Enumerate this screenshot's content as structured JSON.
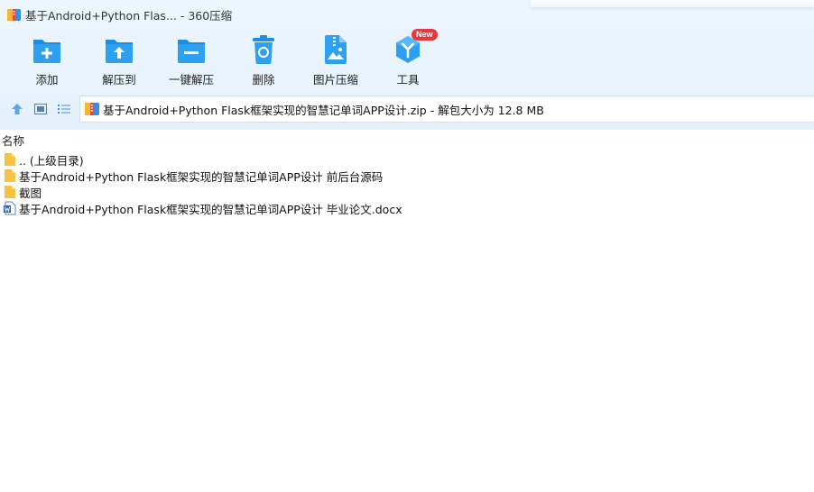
{
  "window": {
    "title": "基于Android+Python Flas... - 360压缩"
  },
  "toolbar": {
    "items": [
      {
        "label": "添加",
        "icon": "add-icon"
      },
      {
        "label": "解压到",
        "icon": "extract-to-icon"
      },
      {
        "label": "一键解压",
        "icon": "one-click-extract-icon"
      },
      {
        "label": "删除",
        "icon": "delete-icon"
      },
      {
        "label": "图片压缩",
        "icon": "image-compress-icon"
      },
      {
        "label": "工具",
        "icon": "tools-icon",
        "badge": "New"
      }
    ]
  },
  "address": {
    "path": "基于Android+Python Flask框架实现的智慧记单词APP设计.zip - 解包大小为 12.8 MB"
  },
  "list": {
    "column_name": "名称",
    "rows": [
      {
        "name": ".. (上级目录)",
        "icon": "folder-icon"
      },
      {
        "name": "基于Android+Python Flask框架实现的智慧记单词APP设计 前后台源码",
        "icon": "folder-icon"
      },
      {
        "name": "截图",
        "icon": "folder-icon"
      },
      {
        "name": "基于Android+Python Flask框架实现的智慧记单词APP设计 毕业论文.docx",
        "icon": "word-doc-icon"
      }
    ]
  },
  "colors": {
    "accent": "#1a8fe3",
    "toolbar_bg": "#e6f1fb",
    "folder": "#f5c341",
    "badge": "#e8363c"
  }
}
